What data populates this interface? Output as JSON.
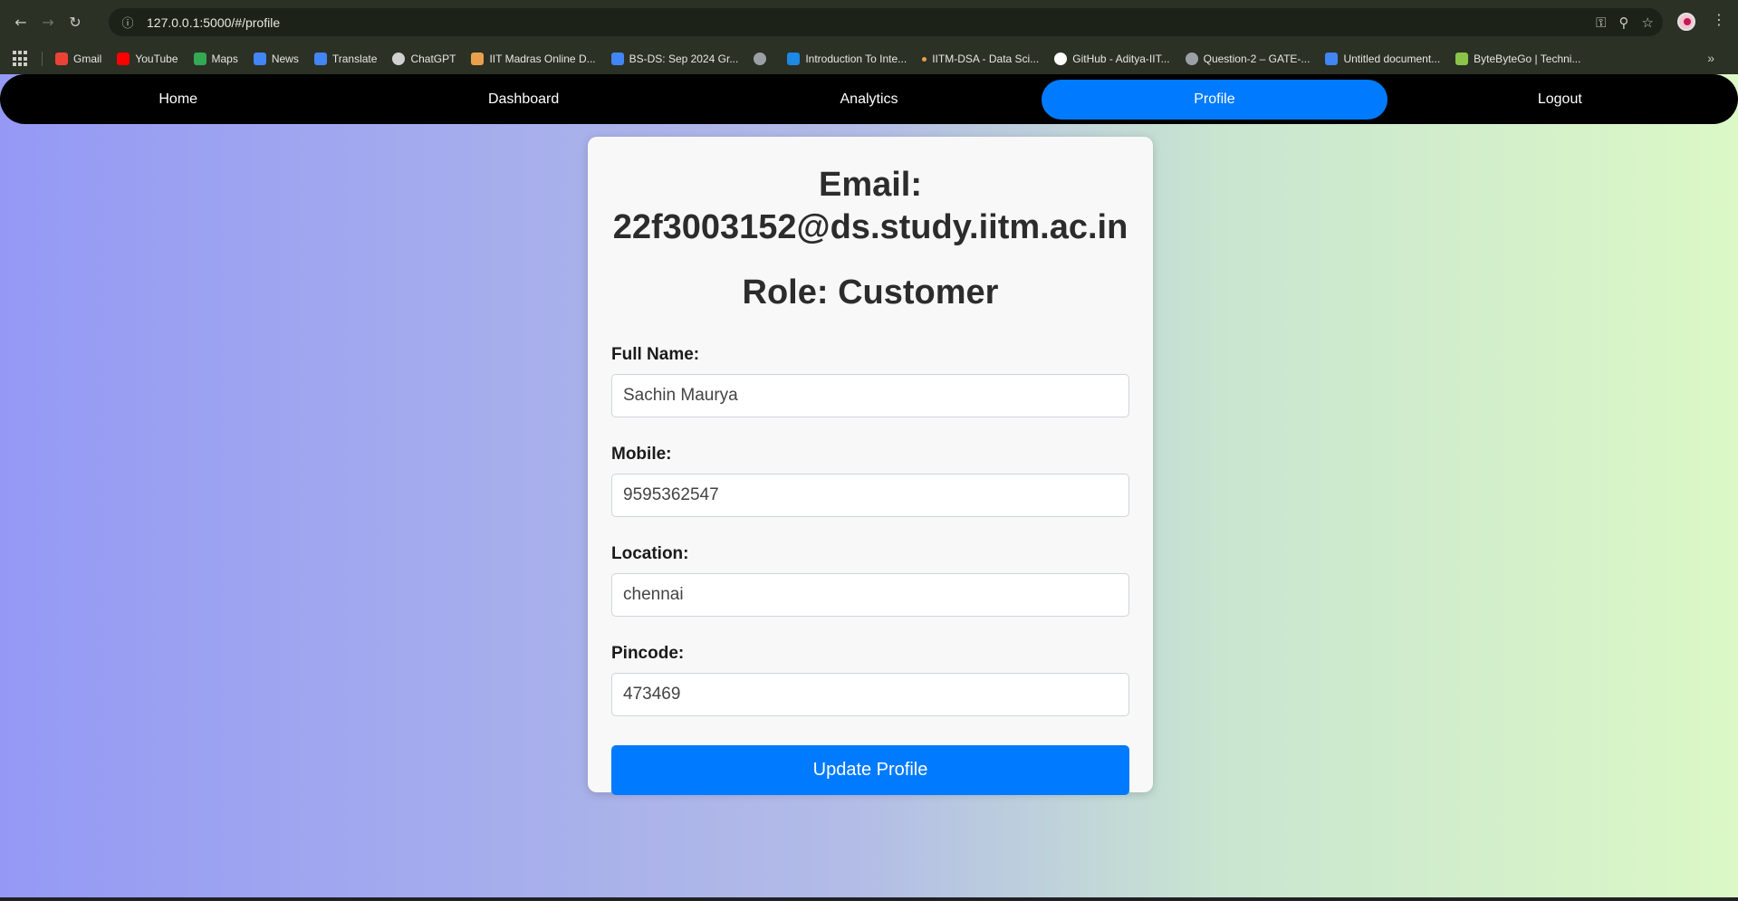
{
  "browser": {
    "url": "127.0.0.1:5000/#/profile",
    "bookmarks": [
      {
        "label": "Gmail",
        "icon": "gmail-icon",
        "color": "#ea4335"
      },
      {
        "label": "YouTube",
        "icon": "youtube-icon",
        "color": "#ff0000"
      },
      {
        "label": "Maps",
        "icon": "maps-icon",
        "color": "#34a853"
      },
      {
        "label": "News",
        "icon": "news-icon",
        "color": "#4285f4"
      },
      {
        "label": "Translate",
        "icon": "translate-icon",
        "color": "#4285f4"
      },
      {
        "label": "ChatGPT",
        "icon": "chatgpt-icon",
        "color": "#d0d0d0"
      },
      {
        "label": "IIT Madras Online D...",
        "icon": "iitm-icon",
        "color": "#e8a04c"
      },
      {
        "label": "BS-DS: Sep 2024 Gr...",
        "icon": "docs-icon",
        "color": "#4285f4"
      },
      {
        "label": "",
        "icon": "globe-icon",
        "color": "#9aa0a6"
      },
      {
        "label": "Introduction To Inte...",
        "icon": "course-icon",
        "color": "#1e88e5"
      },
      {
        "label": "IITM-DSA - Data Sci...",
        "icon": "dot-icon",
        "color": "#e8a04c"
      },
      {
        "label": "GitHub - Aditya-IIT...",
        "icon": "github-icon",
        "color": "#ffffff"
      },
      {
        "label": "Question-2 – GATE-...",
        "icon": "globe-icon",
        "color": "#9aa0a6"
      },
      {
        "label": "Untitled document...",
        "icon": "docs-icon",
        "color": "#4285f4"
      },
      {
        "label": "ByteByteGo | Techni...",
        "icon": "bytebytego-icon",
        "color": "#8bc34a"
      }
    ]
  },
  "nav": {
    "items": [
      {
        "label": "Home",
        "active": false
      },
      {
        "label": "Dashboard",
        "active": false
      },
      {
        "label": "Analytics",
        "active": false
      },
      {
        "label": "Profile",
        "active": true
      },
      {
        "label": "Logout",
        "active": false
      }
    ]
  },
  "profile": {
    "email_line1": "Email:",
    "email_line2": "22f3003152@ds.study.iitm.ac.in",
    "role": "Role: Customer",
    "full_name_label": "Full Name:",
    "full_name_value": "Sachin Maurya",
    "mobile_label": "Mobile:",
    "mobile_value": "9595362547",
    "location_label": "Location:",
    "location_value": "chennai",
    "pincode_label": "Pincode:",
    "pincode_value": "473469",
    "submit_label": "Update Profile"
  },
  "colors": {
    "primary": "#007bff",
    "nav_bg": "#000000",
    "card_bg": "#f8f8f8"
  }
}
